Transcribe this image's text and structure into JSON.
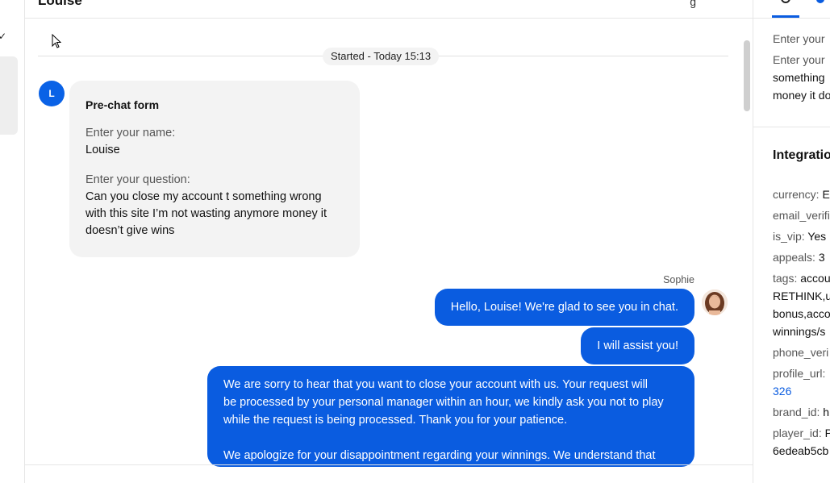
{
  "chat": {
    "header_title": "Louise",
    "started_label": "Started - Today 15:13",
    "customer_avatar_letter": "L",
    "prechat": {
      "title": "Pre-chat form",
      "name_label": "Enter your name:",
      "name_value": "Louise",
      "question_label": "Enter your question:",
      "question_lines": [
        "Can you close my account t something wrong",
        "with this site I’m not wasting anymore money it",
        "doesn’t give wins"
      ]
    },
    "agent_name": "Sophie",
    "messages": [
      "Hello, Louise! We're glad to see you in chat.",
      "I will assist you!"
    ],
    "long_message": {
      "lines1": [
        "We are sorry to hear that you want to close your account with us. Your request will",
        "be processed by your personal manager within an hour, we kindly ask you not to play",
        "while the request is being processed. Thank you for your patience."
      ],
      "line2": "We apologize for your disappointment regarding your winnings. We understand that"
    }
  },
  "details": {
    "enter_your_1": "Enter your",
    "enter_your_2": "Enter your",
    "something": "something",
    "money_it": "money it do",
    "integrations_heading": "Integratio",
    "fields": [
      {
        "key": "currency:",
        "value": "E"
      },
      {
        "key": "email_verifi",
        "value": ""
      },
      {
        "key": "is_vip:",
        "value": "Yes"
      },
      {
        "key": "appeals:",
        "value": "3"
      },
      {
        "key": "tags:",
        "value": "accou"
      },
      {
        "key": "",
        "value": "RETHINK,u"
      },
      {
        "key": "",
        "value": "bonus,acco"
      },
      {
        "key": "",
        "value": "winnings/s"
      },
      {
        "key": "phone_veri",
        "value": ""
      },
      {
        "key": "profile_url:",
        "value": ""
      },
      {
        "key": "",
        "value": "326"
      },
      {
        "key": "brand_id:",
        "value": "h"
      },
      {
        "key": "player_id:",
        "value": "P"
      },
      {
        "key": "",
        "value": "6edeab5cb"
      }
    ]
  },
  "colors": {
    "accent": "#0a5ce0",
    "bubble_in": "#f3f3f3"
  }
}
